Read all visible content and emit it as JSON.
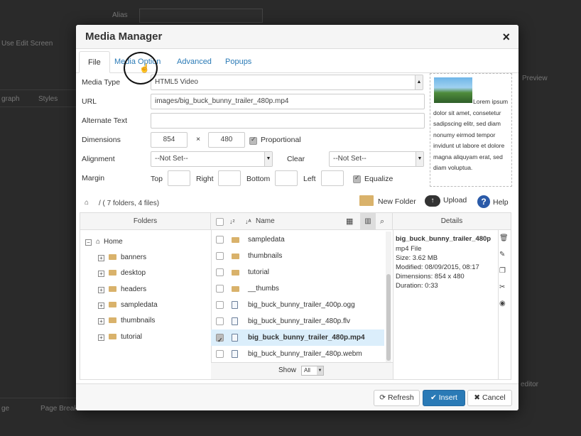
{
  "background": {
    "alias_label": "Alias",
    "tab1": "Use Edit Screen",
    "paragraph_label": "graph",
    "styles_label": "Styles",
    "preview_label": "Preview",
    "page_break_label": "Page Break",
    "ge_label": "ge",
    "editor_label": "editor"
  },
  "modal": {
    "title": "Media Manager",
    "close": "×"
  },
  "tabs": [
    {
      "label": "File"
    },
    {
      "label": "Media Option"
    },
    {
      "label": "Advanced"
    },
    {
      "label": "Popups"
    }
  ],
  "form": {
    "media_type_label": "Media Type",
    "media_type_value": "HTML5 Video",
    "url_label": "URL",
    "url_value": "images/big_buck_bunny_trailer_480p.mp4",
    "alt_label": "Alternate Text",
    "alt_value": "",
    "dimensions_label": "Dimensions",
    "width": "854",
    "times": "×",
    "height": "480",
    "proportional_label": "Proportional",
    "alignment_label": "Alignment",
    "alignment_value": "--Not Set--",
    "clear_label": "Clear",
    "clear_value": "--Not Set--",
    "margin_label": "Margin",
    "top_label": "Top",
    "right_label": "Right",
    "bottom_label": "Bottom",
    "left_label": "Left",
    "equalize_label": "Equalize"
  },
  "preview_text": "Lorem ipsum dolor sit amet, consetetur sadipscing elitr, sed diam nonumy eirmod tempor invidunt ut labore et dolore magna aliquyam erat, sed diam voluptua.",
  "toolbar": {
    "path": "/ ( 7 folders, 4 files)",
    "new_folder": "New Folder",
    "upload": "Upload",
    "help": "Help"
  },
  "columns": {
    "folders": "Folders",
    "name": "Name",
    "details": "Details"
  },
  "tree": {
    "root": "Home",
    "children": [
      "banners",
      "desktop",
      "headers",
      "sampledata",
      "thumbnails",
      "tutorial"
    ]
  },
  "files": [
    {
      "name": "sampledata",
      "kind": "folder"
    },
    {
      "name": "thumbnails",
      "kind": "folder"
    },
    {
      "name": "tutorial",
      "kind": "folder"
    },
    {
      "name": "__thumbs",
      "kind": "folder"
    },
    {
      "name": "big_buck_bunny_trailer_400p.ogg",
      "kind": "file"
    },
    {
      "name": "big_buck_bunny_trailer_480p.flv",
      "kind": "file"
    },
    {
      "name": "big_buck_bunny_trailer_480p.mp4",
      "kind": "file",
      "selected": true
    },
    {
      "name": "big_buck_bunny_trailer_480p.webm",
      "kind": "file"
    }
  ],
  "show": {
    "label": "Show",
    "value": "All"
  },
  "details": {
    "name": "big_buck_bunny_trailer_480p",
    "type": "mp4 File",
    "size": "Size: 3.62 MB",
    "modified": "Modified: 08/09/2015, 08:17",
    "dimensions": "Dimensions: 854 x 480",
    "duration": "Duration: 0:33"
  },
  "buttons": {
    "refresh": "Refresh",
    "insert": "Insert",
    "cancel": "Cancel"
  },
  "colors": {
    "accent": "#2a7ab6",
    "selected_row": "#dbeefb",
    "folder": "#d9b26b"
  }
}
